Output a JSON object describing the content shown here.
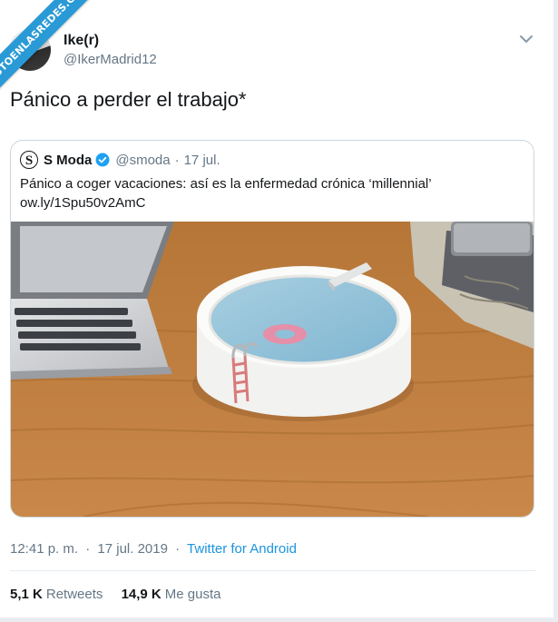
{
  "watermark": {
    "text": "VISTOENLASREDES.COM"
  },
  "tweet": {
    "author_name": "Ike(r)",
    "author_handle": "@IkerMadrid12",
    "text": "Pánico a perder el trabajo*",
    "time": "12:41 p. m.",
    "date": "17 jul. 2019",
    "source": "Twitter for Android",
    "separator": "·"
  },
  "quoted_tweet": {
    "logo_letter": "S",
    "author_name": "S Moda",
    "author_handle": "@smoda",
    "separator": "·",
    "date": "17 jul.",
    "text_line1": "Pánico a coger vacaciones: así es la enfermedad crónica ‘millennial’",
    "text_line2": "ow.ly/1Spu50v2AmC",
    "image_icon": "ashtray-pool-photo"
  },
  "stats": {
    "retweets_count": "5,1 K",
    "retweets_label": "Retweets",
    "likes_count": "14,9 K",
    "likes_label": "Me gusta"
  },
  "icons": {
    "menu": "chevron-down-icon",
    "verified": "verified-badge-icon"
  },
  "colors": {
    "link": "#1b95e0",
    "secondary_text": "#657786",
    "verified": "#1da1f2",
    "watermark": "#2a9ad6"
  }
}
